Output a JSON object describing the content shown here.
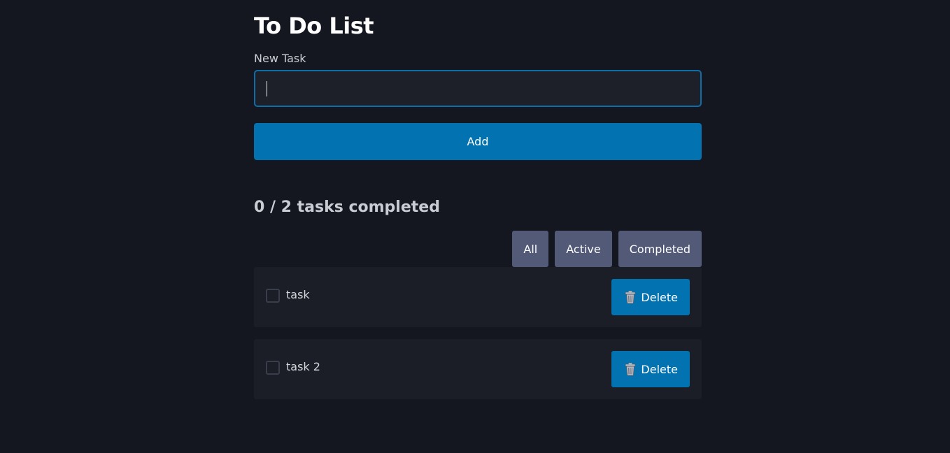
{
  "header": {
    "title": "To Do List"
  },
  "form": {
    "label": "New Task",
    "input_value": "",
    "placeholder": "",
    "add_label": "Add"
  },
  "summary": {
    "text": "0 / 2 tasks completed"
  },
  "filters": [
    {
      "label": "All"
    },
    {
      "label": "Active"
    },
    {
      "label": "Completed"
    }
  ],
  "tasks": [
    {
      "text": "task",
      "completed": false,
      "delete_label": "Delete",
      "icon": "trash-icon"
    },
    {
      "text": "task 2",
      "completed": false,
      "delete_label": "Delete",
      "icon": "trash-icon"
    }
  ],
  "colors": {
    "background": "#14171f",
    "accent": "#0272b1",
    "filter_button": "#525a78",
    "task_row": "#1b1e26"
  }
}
